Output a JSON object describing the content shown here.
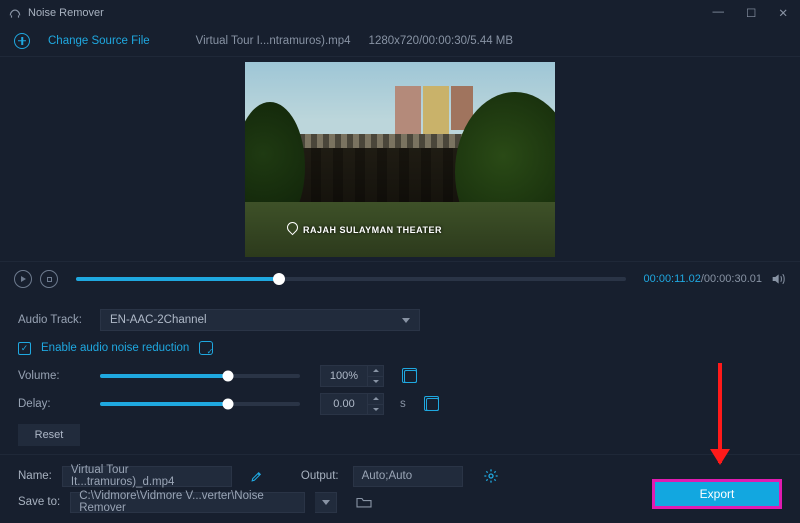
{
  "titlebar": {
    "title": "Noise Remover"
  },
  "sourcebar": {
    "change_label": "Change Source File",
    "filename": "Virtual Tour I...ntramuros).mp4",
    "metadata": "1280x720/00:00:30/5.44 MB"
  },
  "preview": {
    "caption": "RAJAH SULAYMAN THEATER"
  },
  "playback": {
    "current": "00:00:11.02",
    "total": "/00:00:30.01",
    "progress_pct": 37
  },
  "audio": {
    "track_label": "Audio Track:",
    "track_value": "EN-AAC-2Channel",
    "noise_checked": true,
    "noise_label": "Enable audio noise reduction",
    "volume_label": "Volume:",
    "volume_value": "100%",
    "volume_pct": 64,
    "delay_label": "Delay:",
    "delay_value": "0.00",
    "delay_pct": 64,
    "delay_unit": "s",
    "reset_label": "Reset"
  },
  "output": {
    "name_label": "Name:",
    "name_value": "Virtual Tour It...tramuros)_d.mp4",
    "output_label": "Output:",
    "output_value": "Auto;Auto",
    "saveto_label": "Save to:",
    "saveto_value": "C:\\Vidmore\\Vidmore V...verter\\Noise Remover"
  },
  "export_label": "Export"
}
